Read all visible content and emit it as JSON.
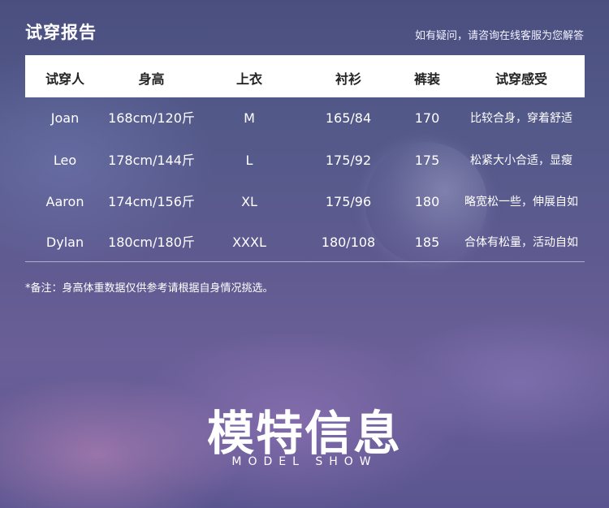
{
  "header": {
    "title": "试穿报告",
    "subtitle": "如有疑问，请咨询在线客服为您解答"
  },
  "table": {
    "columns": [
      "试穿人",
      "身高",
      "上衣",
      "衬衫",
      "裤装",
      "试穿感受"
    ],
    "rows": [
      [
        "Joan",
        "168cm/120斤",
        "M",
        "165/84",
        "170",
        "比较合身，穿着舒适"
      ],
      [
        "Leo",
        "178cm/144斤",
        "L",
        "175/92",
        "175",
        "松紧大小合适，显瘦"
      ],
      [
        "Aaron",
        "174cm/156斤",
        "XL",
        "175/96",
        "180",
        "略宽松一些，伸展自如"
      ],
      [
        "Dylan",
        "180cm/180斤",
        "XXXL",
        "180/108",
        "185",
        "合体有松量，活动自如"
      ]
    ]
  },
  "note": "*备注：身高体重数据仅供参考请根据自身情况挑选。",
  "section": {
    "title": "模特信息",
    "subtitle": "MODEL SHOW"
  }
}
